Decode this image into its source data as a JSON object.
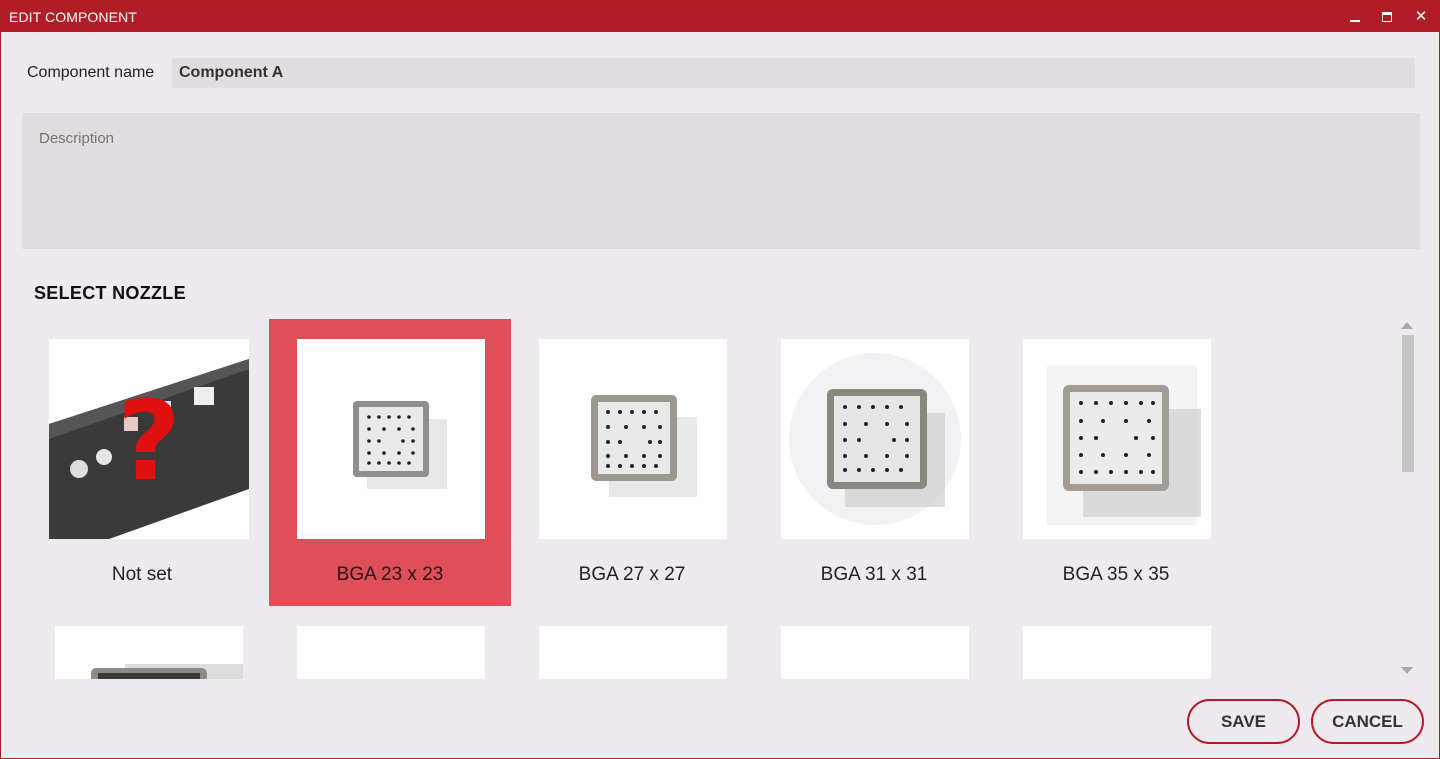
{
  "window": {
    "title": "EDIT COMPONENT",
    "accent_color": "#b11d27",
    "selected_color": "#de4f59"
  },
  "form": {
    "name_label": "Component name",
    "name_value": "Component A",
    "description_placeholder": "Description",
    "description_value": ""
  },
  "nozzle_section": {
    "title": "SELECT NOZZLE",
    "items": [
      {
        "label": "Not set",
        "selected": false,
        "icon": "question-mark-image"
      },
      {
        "label": "BGA 23 x 23",
        "selected": true,
        "icon": "nozzle-image"
      },
      {
        "label": "BGA 27 x 27",
        "selected": false,
        "icon": "nozzle-image"
      },
      {
        "label": "BGA 31 x 31",
        "selected": false,
        "icon": "nozzle-image"
      },
      {
        "label": "BGA 35 x 35",
        "selected": false,
        "icon": "nozzle-image"
      }
    ]
  },
  "actions": {
    "save_label": "SAVE",
    "cancel_label": "CANCEL"
  }
}
